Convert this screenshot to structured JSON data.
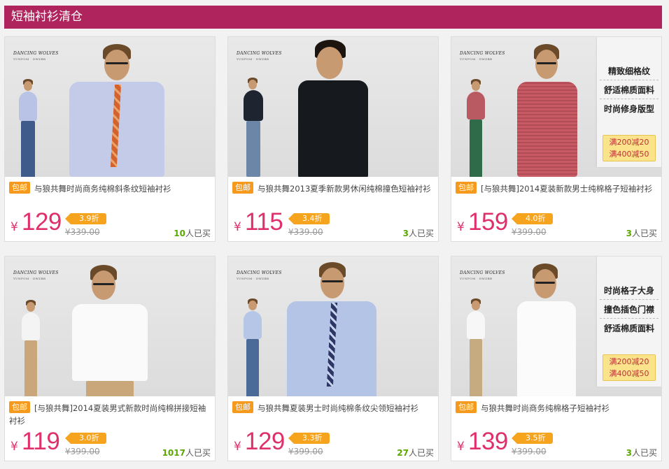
{
  "header": {
    "title": "短袖衬衫清仓"
  },
  "colors": {
    "header_bg": "#b0245e",
    "price": "#e0306c",
    "tag": "#f59a1d",
    "sold": "#5ba800"
  },
  "brand_logo": {
    "name": "DANCING WOLVES",
    "sub": "YUNFOM · DWZBB"
  },
  "products": [
    {
      "tag": "包邮",
      "title": "与狼共舞时尚商务纯棉斜条纹短袖衬衫",
      "currency": "¥",
      "price": "129",
      "discount": "3.9折",
      "original_price": "¥339.00",
      "sold_count": "10",
      "sold_suffix": "人已买"
    },
    {
      "tag": "包邮",
      "title": "与狼共舞2013夏季新款男休闲纯棉撞色短袖衬衫",
      "currency": "¥",
      "price": "115",
      "discount": "3.4折",
      "original_price": "¥339.00",
      "sold_count": "3",
      "sold_suffix": "人已买"
    },
    {
      "tag": "包邮",
      "title": "[与狼共舞]2014夏装新款男士纯棉格子短袖衬衫",
      "currency": "¥",
      "price": "159",
      "discount": "4.0折",
      "original_price": "¥399.00",
      "sold_count": "3",
      "sold_suffix": "人已买",
      "promo_lines": [
        "精致细格纹",
        "舒适棉质面料",
        "时尚修身版型"
      ],
      "promo_deals": [
        "满200减20",
        "满400减50"
      ]
    },
    {
      "tag": "包邮",
      "title": "[与狼共舞]2014夏装男式新款时尚纯棉拼接短袖衬衫",
      "currency": "¥",
      "price": "119",
      "discount": "3.0折",
      "original_price": "¥399.00",
      "sold_count": "1017",
      "sold_suffix": "人已买"
    },
    {
      "tag": "包邮",
      "title": "与狼共舞夏装男士时尚纯棉条纹尖领短袖衬衫",
      "currency": "¥",
      "price": "129",
      "discount": "3.3折",
      "original_price": "¥399.00",
      "sold_count": "27",
      "sold_suffix": "人已买"
    },
    {
      "tag": "包邮",
      "title": "与狼共舞时尚商务纯棉格子短袖衬衫",
      "currency": "¥",
      "price": "139",
      "discount": "3.5折",
      "original_price": "¥399.00",
      "sold_count": "3",
      "sold_suffix": "人已买",
      "promo_lines": [
        "时尚格子大身",
        "撞色插色门襟",
        "舒适棉质面料"
      ],
      "promo_deals": [
        "满200减20",
        "满400减50"
      ]
    }
  ]
}
